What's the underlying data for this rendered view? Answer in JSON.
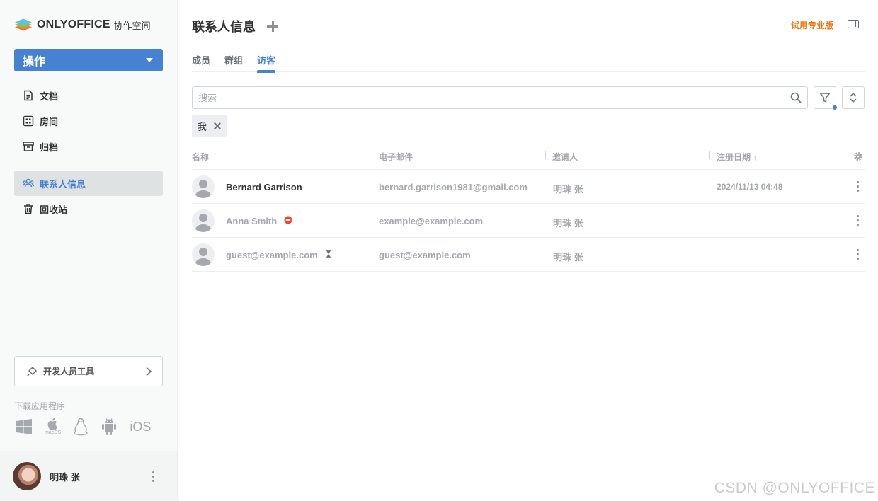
{
  "app": {
    "logo_text": "ONLYOFFICE",
    "logo_sub": "协作空间",
    "actions_label": "操作"
  },
  "sidebar": {
    "items": [
      {
        "label": "文档",
        "icon": "document-icon"
      },
      {
        "label": "房间",
        "icon": "rooms-icon"
      },
      {
        "label": "归档",
        "icon": "archive-icon"
      },
      {
        "label": "联系人信息",
        "icon": "contacts-icon",
        "active": true
      },
      {
        "label": "回收站",
        "icon": "trash-icon"
      }
    ],
    "dev_tools_label": "开发人员工具",
    "download_title": "下载应用程序",
    "apps": [
      "windows-icon",
      "macos-icon",
      "linux-icon",
      "android-icon",
      "ios-icon"
    ],
    "apps_macos_label": "macOS",
    "apps_ios_label": "iOS",
    "profile_name": "明珠 张"
  },
  "header": {
    "title": "联系人信息",
    "trial_label": "试用专业版"
  },
  "tabs": [
    {
      "label": "成员",
      "active": false
    },
    {
      "label": "群组",
      "active": false
    },
    {
      "label": "访客",
      "active": true
    }
  ],
  "search": {
    "placeholder": "搜索",
    "value": ""
  },
  "filter_chip": {
    "label": "我"
  },
  "table": {
    "columns": [
      "名称",
      "电子邮件",
      "邀请人",
      "注册日期"
    ],
    "sort_indicator": "↑",
    "rows": [
      {
        "name": "Bernard Garrison",
        "email": "bernard.garrison1981@gmail.com",
        "inviter": "明珠 张",
        "date": "2024/11/13 04:48",
        "status": "",
        "muted": false
      },
      {
        "name": "Anna Smith",
        "email": "example@example.com",
        "inviter": "明珠 张",
        "date": "",
        "status": "blocked-icon",
        "muted": true
      },
      {
        "name": "guest@example.com",
        "email": "guest@example.com",
        "inviter": "明珠 张",
        "date": "",
        "status": "pending-icon",
        "muted": true
      }
    ]
  },
  "watermark": "CSDN @ONLYOFFICE",
  "colors": {
    "accent": "#4781d1",
    "trial": "#ed7309",
    "blocked": "#f2432e",
    "muted_text": "#a3a9ae"
  }
}
